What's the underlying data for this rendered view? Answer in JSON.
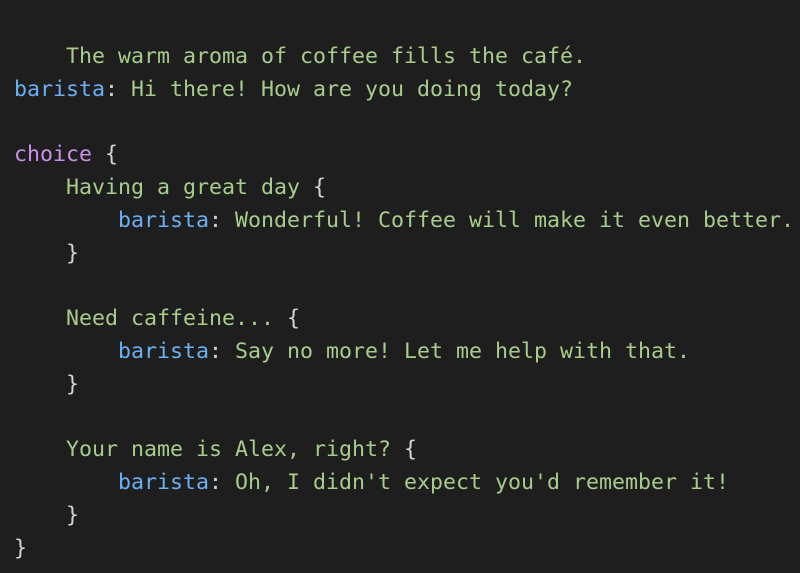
{
  "narration": "The warm aroma of coffee fills the café.",
  "intro": {
    "speaker": "barista",
    "colon": ":",
    "line": " Hi there! How are you doing today?"
  },
  "choice": {
    "keyword": "choice",
    "open_brace": " {",
    "close_brace": "}",
    "options": [
      {
        "label": "Having a great day",
        "open_brace": " {",
        "speaker": "barista",
        "colon": ":",
        "reply": " Wonderful! Coffee will make it even better.",
        "close_brace": "}"
      },
      {
        "label": "Need caffeine...",
        "open_brace": " {",
        "speaker": "barista",
        "colon": ":",
        "reply": " Say no more! Let me help with that.",
        "close_brace": "}"
      },
      {
        "label": "Your name is Alex, right?",
        "open_brace": " {",
        "speaker": "barista",
        "colon": ":",
        "reply": " Oh, I didn't expect you'd remember it!",
        "close_brace": "}"
      }
    ]
  },
  "colors": {
    "background": "#1e1e1e",
    "text": "#a8cc8c",
    "speaker": "#6ab0f3",
    "keyword": "#c792ea",
    "punctuation": "#d4d4d4"
  }
}
